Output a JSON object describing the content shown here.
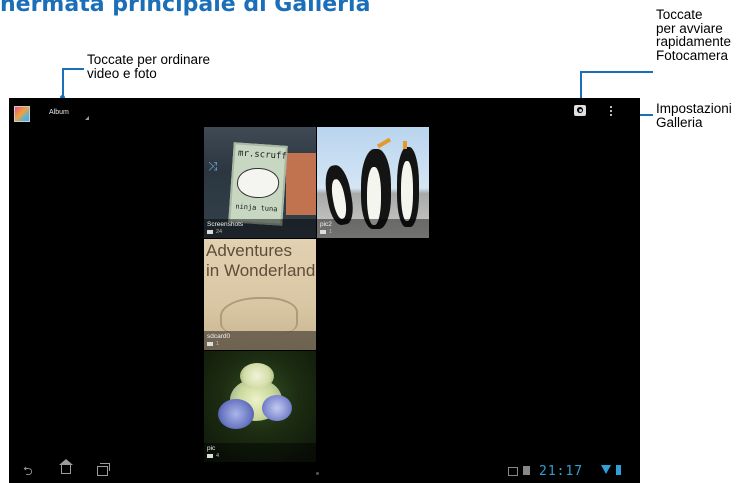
{
  "page": {
    "title": "hermata principale di Galleria"
  },
  "callouts": {
    "sort": "Toccate per ordinare\nvideo e foto",
    "camera": "Toccate\nper avviare\nrapidamente\nFotocamera",
    "settings": "Impostazioni\nGalleria"
  },
  "gallery": {
    "actionbar": {
      "title": "Album"
    },
    "albums": [
      {
        "name": "Screenshots",
        "count": "24"
      },
      {
        "name": "pic2",
        "count": "1"
      },
      {
        "name": "sdcard0",
        "count": "1"
      },
      {
        "name": "pic",
        "count": "4"
      }
    ],
    "thumb_text": {
      "mrscruff": "mr.scruff",
      "ninjatuna": "ninja tuna",
      "alice": "Adventures\nin Wonderland"
    }
  },
  "statusbar": {
    "time": "21:17"
  },
  "colors": {
    "accent": "#1b6fb8",
    "status": "#2fa1d6"
  },
  "icons": [
    "gallery-app-icon",
    "camera-icon",
    "overflow-menu-icon",
    "back-icon",
    "home-icon",
    "recent-apps-icon",
    "wifi-icon",
    "battery-icon"
  ]
}
